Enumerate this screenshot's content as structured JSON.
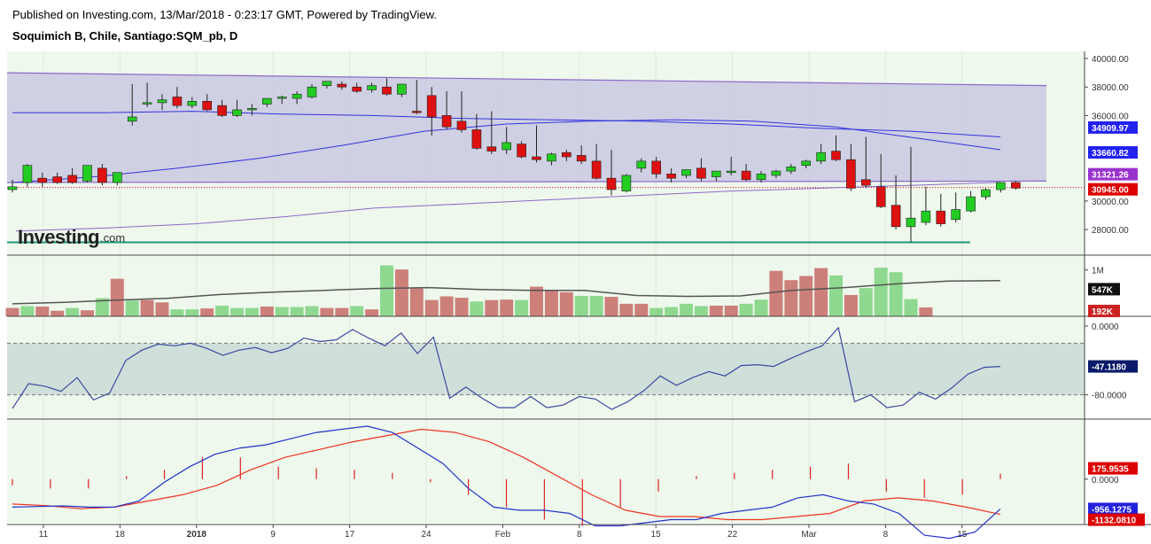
{
  "header": {
    "published": "Published on Investing.com, 13/Mar/2018 - 0:23:17 GMT, Powered by TradingView.",
    "symbol": "Soquimich B, Chile, Santiago:SQM_pb, D"
  },
  "colors": {
    "up": "#22cc22",
    "down": "#dd1111",
    "vol_up": "#8fd88f",
    "vol_down": "#cd7f7a",
    "channel_fill": "#c9c9e2",
    "channel_line": "#8c68c8",
    "ma_blue": "#3333dd",
    "macd_line": "#2233cc",
    "signal_line": "#ee3322",
    "hist": "#dd2222",
    "support": "#1a9a76",
    "price_line": "#dd0000"
  },
  "logo": {
    "main": "Investing",
    "suffix": ".com"
  },
  "chart_data": [
    {
      "type": "candlestick",
      "panel": "price",
      "title": "",
      "y_ticks": [
        "40000.00",
        "38000.00",
        "36000.00",
        "30000.00",
        "28000.00"
      ],
      "ylim": [
        26200,
        40500
      ],
      "x_ticks": [
        "11",
        "18",
        "2018",
        "9",
        "17",
        "24",
        "Feb",
        "8",
        "15",
        "22",
        "Mar",
        "8",
        "15"
      ],
      "candles": [
        [
          30800,
          31500,
          31000,
          30600
        ],
        [
          31300,
          32600,
          32500,
          31000
        ],
        [
          31600,
          32000,
          31300,
          31000
        ],
        [
          31700,
          32000,
          31300,
          31200
        ],
        [
          31800,
          32300,
          31300,
          31200
        ],
        [
          31400,
          32200,
          32500,
          31300
        ],
        [
          32300,
          32600,
          31300,
          31100
        ],
        [
          31300,
          31300,
          32000,
          31100
        ],
        [
          35600,
          38200,
          35900,
          35300
        ],
        [
          36900,
          38300,
          36900,
          36600
        ],
        [
          36900,
          37500,
          37100,
          36400
        ],
        [
          37300,
          38000,
          36700,
          36500
        ],
        [
          36700,
          37300,
          37000,
          36500
        ],
        [
          37000,
          37500,
          36400,
          36300
        ],
        [
          36700,
          37100,
          36000,
          35900
        ],
        [
          36000,
          37100,
          36400,
          35900
        ],
        [
          36400,
          36800,
          36500,
          36000
        ],
        [
          36800,
          37000,
          37200,
          36600
        ],
        [
          37200,
          37400,
          37300,
          36800
        ],
        [
          37200,
          37700,
          37500,
          36800
        ],
        [
          37300,
          38200,
          38000,
          37200
        ],
        [
          38100,
          38300,
          38400,
          37900
        ],
        [
          38200,
          38400,
          38000,
          37800
        ],
        [
          38000,
          38300,
          37700,
          37600
        ],
        [
          37800,
          38300,
          38100,
          37600
        ],
        [
          38000,
          38600,
          37500,
          37400
        ],
        [
          37500,
          38200,
          38200,
          37300
        ],
        [
          36300,
          38500,
          36200,
          36100
        ],
        [
          37400,
          38000,
          35900,
          34600
        ],
        [
          36000,
          37700,
          35200,
          35000
        ],
        [
          35600,
          37700,
          35000,
          34800
        ],
        [
          35000,
          36100,
          33700,
          33600
        ],
        [
          33800,
          36300,
          33500,
          33300
        ],
        [
          33600,
          35200,
          34100,
          33300
        ],
        [
          34000,
          34200,
          33100,
          33000
        ],
        [
          33100,
          35300,
          32900,
          32700
        ],
        [
          32800,
          33400,
          33300,
          32500
        ],
        [
          33400,
          33600,
          33100,
          32800
        ],
        [
          33200,
          33900,
          32800,
          32600
        ],
        [
          32800,
          34000,
          31600,
          31500
        ],
        [
          31600,
          33600,
          30800,
          30400
        ],
        [
          30700,
          31900,
          31800,
          30600
        ],
        [
          32300,
          33000,
          32800,
          32000
        ],
        [
          32800,
          33100,
          31900,
          31600
        ],
        [
          31900,
          32300,
          31600,
          31300
        ],
        [
          31800,
          32200,
          32200,
          31600
        ],
        [
          32300,
          33000,
          31600,
          31400
        ],
        [
          31700,
          32100,
          32100,
          31400
        ],
        [
          32000,
          33100,
          32100,
          31800
        ],
        [
          32100,
          32600,
          31500,
          31400
        ],
        [
          31500,
          32100,
          31900,
          31300
        ],
        [
          31800,
          32200,
          32100,
          31600
        ],
        [
          32100,
          32600,
          32400,
          31900
        ],
        [
          32500,
          32900,
          32800,
          32300
        ],
        [
          32800,
          34000,
          33400,
          32600
        ],
        [
          33500,
          34600,
          32900,
          32800
        ],
        [
          32900,
          34000,
          30900,
          30700
        ],
        [
          31500,
          34500,
          31100,
          30900
        ],
        [
          31000,
          33300,
          29600,
          29500
        ],
        [
          29700,
          31800,
          28200,
          28000
        ],
        [
          28200,
          33800,
          28800,
          27100
        ],
        [
          28500,
          31000,
          29300,
          28300
        ],
        [
          29300,
          30500,
          28400,
          28200
        ],
        [
          28700,
          30600,
          29400,
          28500
        ],
        [
          29300,
          30700,
          30300,
          29200
        ],
        [
          30300,
          30900,
          30800,
          30100
        ],
        [
          30800,
          31300,
          31300,
          30600
        ],
        [
          31300,
          31400,
          30900,
          30800
        ]
      ],
      "channel_top": [
        39000,
        38100
      ],
      "channel_bottom": [
        31300,
        31400
      ],
      "ma_upper": [
        36200,
        36200,
        36300,
        36100,
        36000,
        35800,
        35700,
        35600,
        35400,
        35100,
        34900,
        34500
      ],
      "ma_lower": [
        31300,
        31700,
        32300,
        33000,
        33900,
        34900,
        35400,
        35600,
        35700,
        35600,
        35200,
        34400,
        33600
      ],
      "ma_long": [
        27900,
        28100,
        28400,
        28900,
        29500,
        29800,
        30100,
        30400,
        30700,
        30900,
        31100,
        31320
      ],
      "support_level": 27100,
      "labels": [
        {
          "text": "34909.97",
          "value": 34910,
          "color": "#2222ee"
        },
        {
          "text": "33660.82",
          "value": 33661,
          "color": "#2222ee"
        },
        {
          "text": "31321.26",
          "value": 31321,
          "color": "#9933cc"
        },
        {
          "text": "30945.00",
          "value": 30945,
          "color": "#dd0000"
        }
      ]
    },
    {
      "type": "bar",
      "panel": "volume",
      "y_ticks": [
        "1M"
      ],
      "ylim": [
        0,
        1300000
      ],
      "values": [
        180000,
        220000,
        210000,
        120000,
        180000,
        130000,
        390000,
        810000,
        340000,
        350000,
        300000,
        150000,
        150000,
        170000,
        230000,
        180000,
        180000,
        210000,
        200000,
        200000,
        220000,
        180000,
        180000,
        220000,
        150000,
        1100000,
        1010000,
        600000,
        350000,
        430000,
        400000,
        320000,
        350000,
        360000,
        350000,
        640000,
        570000,
        520000,
        440000,
        440000,
        420000,
        270000,
        270000,
        180000,
        200000,
        270000,
        220000,
        230000,
        230000,
        270000,
        360000,
        980000,
        780000,
        870000,
        1040000,
        880000,
        460000,
        610000,
        1050000,
        950000,
        370000,
        192000
      ],
      "up": [
        0,
        1,
        0,
        0,
        1,
        0,
        1,
        0,
        1,
        0,
        0,
        1,
        1,
        0,
        1,
        1,
        1,
        0,
        1,
        1,
        1,
        0,
        0,
        1,
        0,
        1,
        0,
        0,
        0,
        0,
        0,
        1,
        0,
        0,
        1,
        0,
        0,
        0,
        1,
        1,
        0,
        0,
        0,
        1,
        1,
        1,
        1,
        0,
        0,
        1,
        1,
        0,
        0,
        0,
        0,
        1,
        0,
        1,
        1,
        1,
        1,
        0
      ],
      "ma": [
        270000,
        300000,
        350000,
        390000,
        470000,
        520000,
        560000,
        600000,
        620000,
        580000,
        560000,
        560000,
        450000,
        430000,
        440000,
        560000,
        620000,
        700000,
        760000,
        770000
      ],
      "labels": [
        {
          "text": "547K",
          "value": 547000,
          "color": "#111111"
        },
        {
          "text": "192K",
          "value": 192000,
          "color": "#cc2222"
        }
      ]
    },
    {
      "type": "line",
      "panel": "oscillator",
      "y_ticks": [
        "0.0000",
        "-80.0000"
      ],
      "ylim": [
        -100,
        0
      ],
      "bands": [
        -20,
        -80
      ],
      "values": [
        -96,
        -67,
        -70,
        -76,
        -60,
        -86,
        -78,
        -40,
        -28,
        -21,
        -23,
        -20,
        -26,
        -34,
        -28,
        -25,
        -31,
        -26,
        -14,
        -18,
        -16,
        -4,
        -14,
        -23,
        -8,
        -32,
        -13,
        -84,
        -71,
        -84,
        -95,
        -95,
        -82,
        -95,
        -92,
        -82,
        -85,
        -97,
        -88,
        -75,
        -58,
        -69,
        -60,
        -53,
        -58,
        -46,
        -45,
        -47,
        -38,
        -30,
        -23,
        -2,
        -88,
        -80,
        -95,
        -92,
        -77,
        -85,
        -72,
        -56,
        -48,
        -47
      ],
      "labels": [
        {
          "text": "-47.1180",
          "value": -47,
          "color": "#0a1a6a"
        }
      ]
    },
    {
      "type": "line",
      "panel": "macd",
      "y_ticks": [
        "0.0000"
      ],
      "ylim": [
        -1400,
        1900
      ],
      "macd": [
        -900,
        -880,
        -860,
        -900,
        -900,
        -700,
        -100,
        400,
        800,
        1000,
        1100,
        1300,
        1500,
        1600,
        1700,
        1500,
        1000,
        500,
        -300,
        -900,
        -1000,
        -1000,
        -1100,
        -1500,
        -1500,
        -1400,
        -1300,
        -1300,
        -1100,
        -1000,
        -900,
        -600,
        -500,
        -700,
        -800,
        -1100,
        -1800,
        -1900,
        -1700,
        -956
      ],
      "signal": [
        -800,
        -850,
        -950,
        -900,
        -700,
        -500,
        -200,
        300,
        700,
        950,
        1200,
        1400,
        1600,
        1500,
        1200,
        700,
        100,
        -500,
        -1000,
        -1200,
        -1200,
        -1300,
        -1300,
        -1200,
        -1100,
        -700,
        -600,
        -700,
        -900,
        -1132
      ],
      "histogram": [
        -200,
        -300,
        -300,
        100,
        300,
        700,
        700,
        400,
        350,
        300,
        200,
        -100,
        -500,
        -900,
        -1300,
        -1500,
        -900,
        -400,
        100,
        200,
        300,
        400,
        500,
        -400,
        -600,
        -500,
        175
      ],
      "labels": [
        {
          "text": "175.9535",
          "value": 176,
          "color": "#dd0000"
        },
        {
          "text": "-956.1275",
          "value": -956,
          "color": "#2222dd"
        },
        {
          "text": "-1132.0810",
          "value": -1132,
          "color": "#dd0000"
        }
      ]
    }
  ]
}
